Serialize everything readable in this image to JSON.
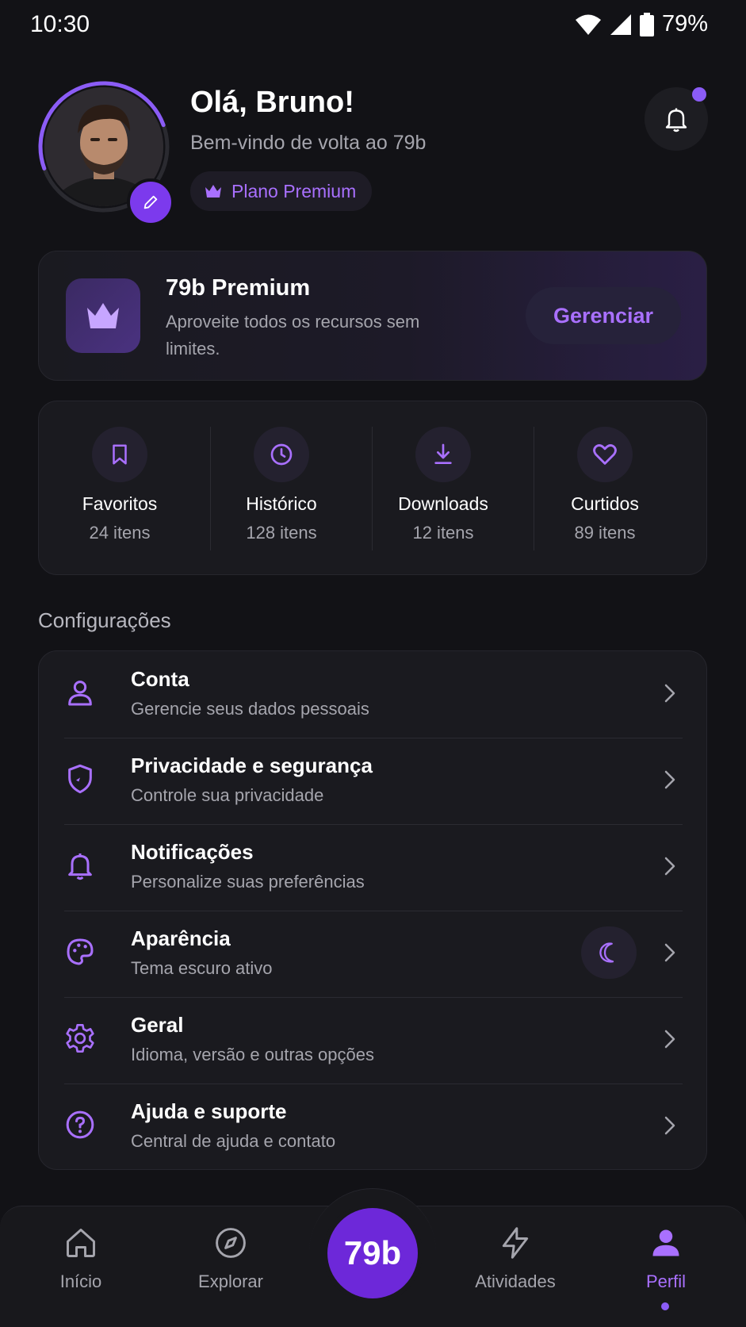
{
  "status_bar": {
    "time": "10:30",
    "battery": "79%"
  },
  "profile": {
    "greeting": "Olá, Bruno!",
    "welcome": "Bem-vindo de volta ao 79b",
    "plan_badge": "Plano Premium"
  },
  "premium_card": {
    "title": "79b Premium",
    "description": "Aproveite todos os recursos sem limites.",
    "manage_button": "Gerenciar"
  },
  "stats": [
    {
      "label": "Favoritos",
      "count": "24 itens",
      "icon": "bookmark-icon"
    },
    {
      "label": "Histórico",
      "count": "128 itens",
      "icon": "clock-icon"
    },
    {
      "label": "Downloads",
      "count": "12 itens",
      "icon": "download-icon"
    },
    {
      "label": "Curtidos",
      "count": "89 itens",
      "icon": "heart-icon"
    }
  ],
  "settings": {
    "section_title": "Configurações",
    "items": [
      {
        "title": "Conta",
        "subtitle": "Gerencie seus dados pessoais",
        "icon": "user-icon"
      },
      {
        "title": "Privacidade e segurança",
        "subtitle": "Controle sua privacidade",
        "icon": "shield-icon"
      },
      {
        "title": "Notificações",
        "subtitle": "Personalize suas preferências",
        "icon": "bell-icon"
      },
      {
        "title": "Aparência",
        "subtitle": "Tema escuro ativo",
        "icon": "palette-icon"
      },
      {
        "title": "Geral",
        "subtitle": "Idioma, versão e outras opções",
        "icon": "gear-icon"
      },
      {
        "title": "Ajuda e suporte",
        "subtitle": "Central de ajuda e contato",
        "icon": "help-icon"
      }
    ]
  },
  "bottom_nav": {
    "items": [
      {
        "label": "Início",
        "icon": "home-icon"
      },
      {
        "label": "Explorar",
        "icon": "compass-icon"
      },
      {
        "label": "Atividades",
        "icon": "lightning-icon"
      },
      {
        "label": "Perfil",
        "icon": "profile-icon"
      }
    ],
    "center_label": "79b",
    "active": "Perfil"
  },
  "colors": {
    "accent": "#8b5cf6",
    "accent_text": "#a970ff",
    "background": "#121216",
    "card": "#1a1a1f"
  }
}
